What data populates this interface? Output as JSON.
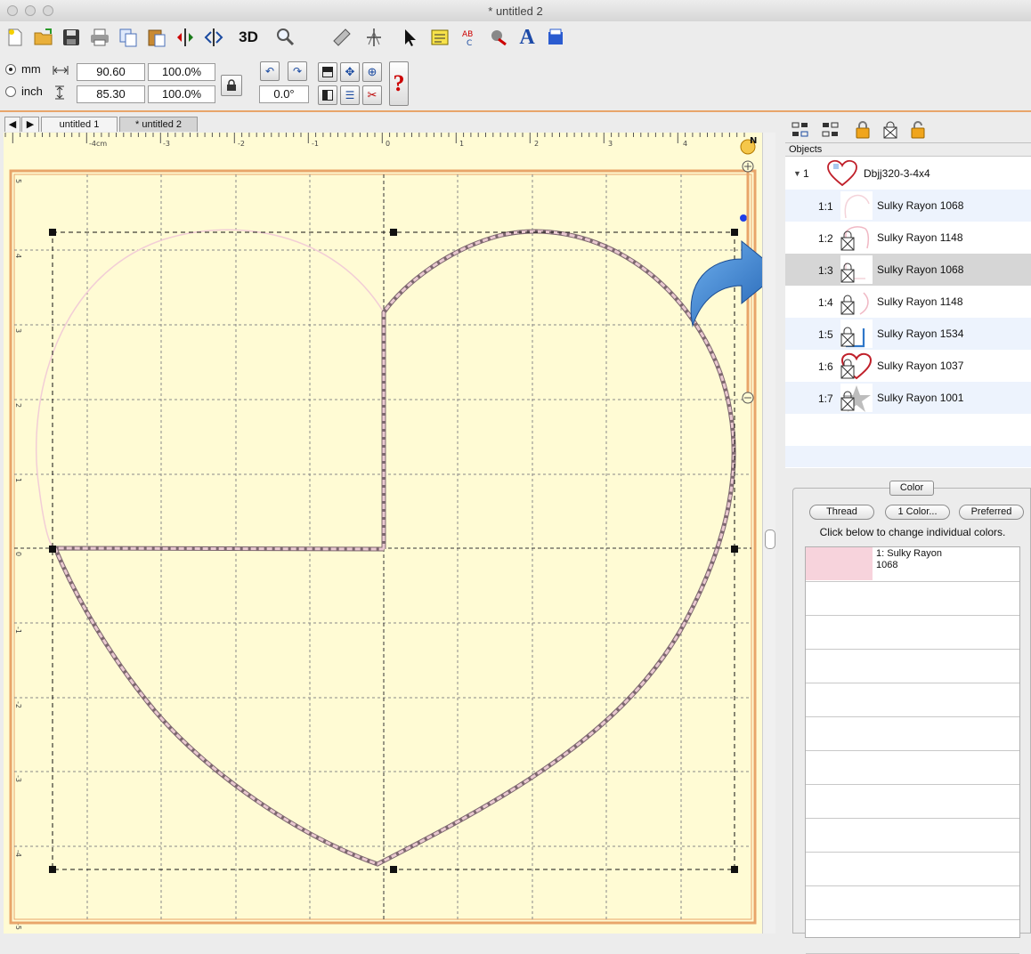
{
  "window": {
    "title": "* untitled 2"
  },
  "toolbar": {
    "items": [
      "new-file-icon",
      "open-folder-icon",
      "save-icon",
      "print-icon",
      "copy-icon",
      "paste-icon",
      "mirror-horizontal-icon",
      "mirror-vertical-icon",
      "3d-view",
      "zoom-icon",
      "ruler-icon",
      "center-icon",
      "pointer-icon",
      "notes-icon",
      "spellcheck-icon",
      "thread-color-icon",
      "text-tool",
      "design-icon"
    ],
    "label_3d": "3D",
    "label_text": "A"
  },
  "properties": {
    "unit_mm": "mm",
    "unit_inch": "inch",
    "selected_unit": "mm",
    "width": "90.60",
    "width_pct": "100.0%",
    "height": "85.30",
    "height_pct": "100.0%",
    "rotation": "0.0°"
  },
  "tabs": [
    {
      "label": "untitled 1",
      "active": false
    },
    {
      "label": "* untitled 2",
      "active": true
    }
  ],
  "ruler": {
    "h_labels": [
      "-4cm",
      "-3",
      "-2",
      "-1",
      "0",
      "1",
      "2",
      "3",
      "4"
    ],
    "v_labels": [
      "5",
      "4",
      "3",
      "2",
      "1",
      "0",
      "-1",
      "-2",
      "-3",
      "-4",
      "-5"
    ]
  },
  "objects": {
    "header": "Objects",
    "group": {
      "index": "1",
      "name": "Dbjj320-3-4x4"
    },
    "items": [
      {
        "index": "1:1",
        "name": "Sulky Rayon 1068"
      },
      {
        "index": "1:2",
        "name": "Sulky Rayon 1148"
      },
      {
        "index": "1:3",
        "name": "Sulky Rayon 1068"
      },
      {
        "index": "1:4",
        "name": "Sulky Rayon 1148"
      },
      {
        "index": "1:5",
        "name": "Sulky Rayon 1534"
      },
      {
        "index": "1:6",
        "name": "Sulky Rayon 1037"
      },
      {
        "index": "1:7",
        "name": "Sulky Rayon 1001"
      }
    ],
    "selected": "1:3"
  },
  "color_panel": {
    "tab": "Color",
    "buttons": {
      "thread": "Thread",
      "one_color": "1 Color...",
      "preferred": "Preferred"
    },
    "hint": "Click below to change individual colors.",
    "entries": [
      {
        "line1": "1: Sulky Rayon",
        "line2": "1068",
        "swatch": "#f7d3dc"
      }
    ]
  },
  "colors": {
    "canvas": "#fffbd4",
    "accent": "#e8a56a",
    "stitch": "#c9a2ad",
    "arrow": "#2f77c9"
  }
}
